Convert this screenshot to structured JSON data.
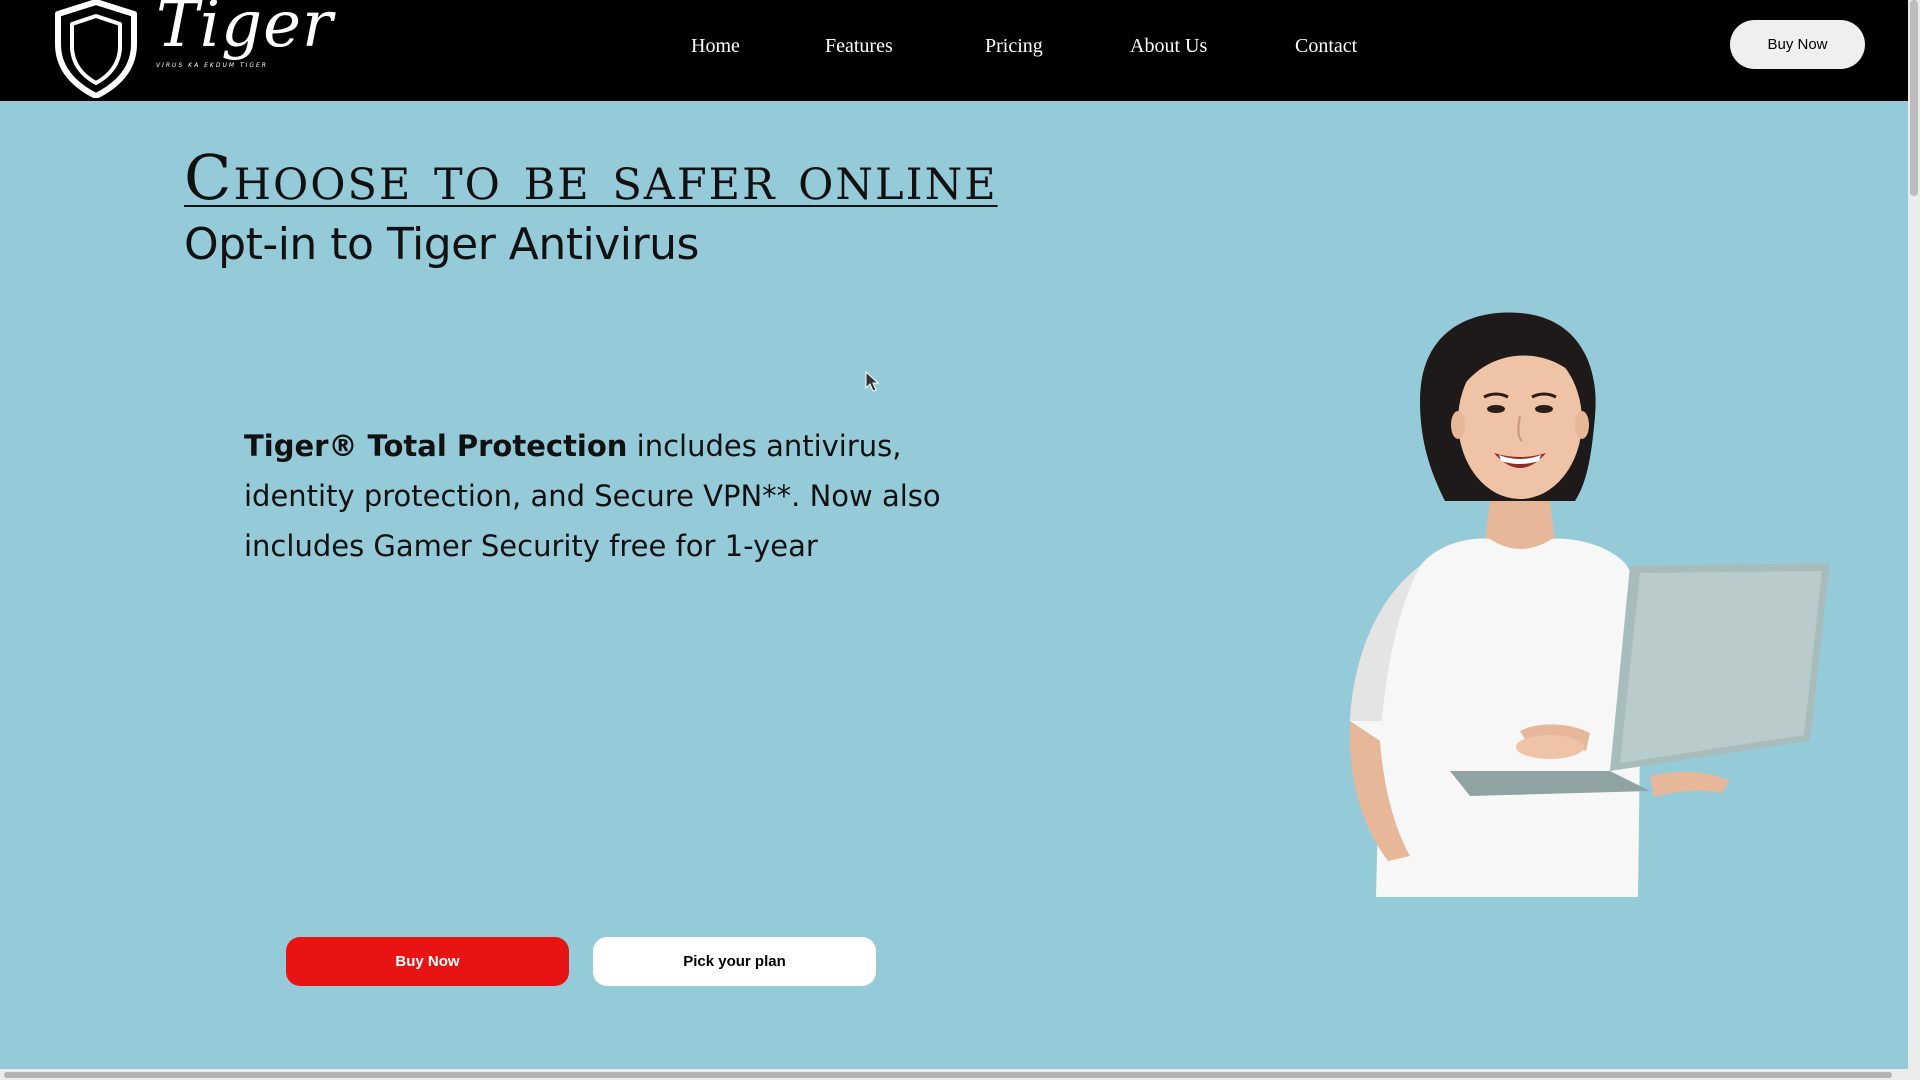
{
  "header": {
    "brand": {
      "name": "Tiger",
      "tagline": "VIRUS KA EKDUM TIGER"
    },
    "nav": [
      {
        "label": "Home"
      },
      {
        "label": "Features"
      },
      {
        "label": "Pricing"
      },
      {
        "label": "About Us"
      },
      {
        "label": "Contact"
      }
    ],
    "buy_button_label": "Buy Now"
  },
  "hero": {
    "title": "Choose to be safer online",
    "subtitle": "Opt-in to Tiger Antivirus",
    "description": {
      "product": "Tiger® Total Protection",
      "text": " includes antivirus, identity protection, and Secure VPN**. Now also includes Gamer Security free for 1-year"
    },
    "primary_button_label": "Buy Now",
    "secondary_button_label": "Pick your plan",
    "image_alt": "Smiling woman holding a laptop"
  },
  "colors": {
    "header_bg": "#000000",
    "hero_bg": "#95cbd9",
    "primary_button": "#e81414",
    "secondary_button": "#ffffff"
  }
}
